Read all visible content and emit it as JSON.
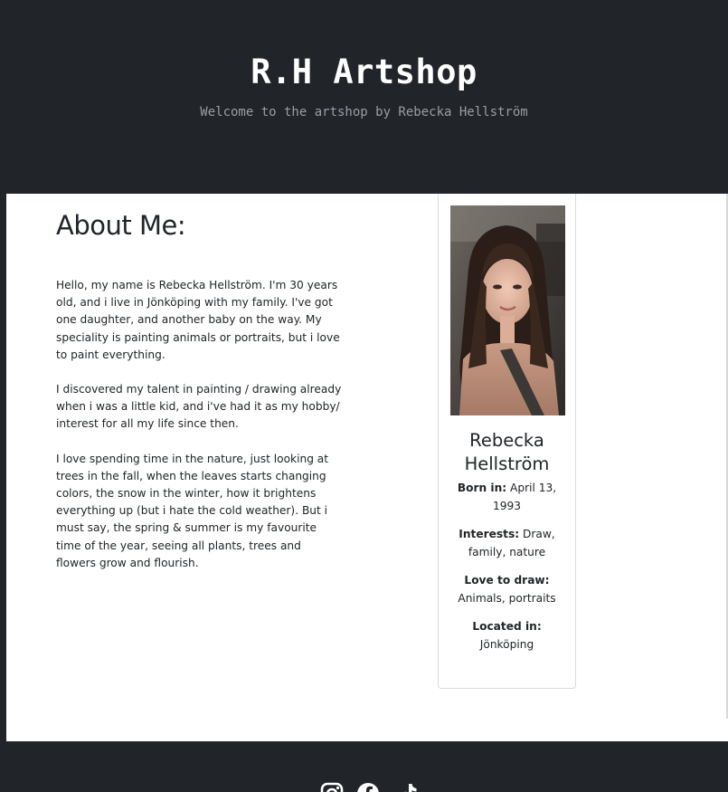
{
  "header": {
    "title": "R.H Artshop",
    "subtitle": "Welcome to the artshop by Rebecka Hellström"
  },
  "about": {
    "heading": "About Me:",
    "paragraphs": [
      "Hello, my name is Rebecka Hellström. I'm 30 years old, and i live in Jönköping with my family. I've got one daughter, and another baby on the way. My speciality is painting animals or portraits, but i love to paint everything.",
      "I discovered my talent in painting / drawing already when i was a little kid, and i've had it as my hobby/ interest for all my life since then.",
      "I love spending time in the nature, just looking at trees in the fall, when the leaves starts changing colors, the snow in the winter, how it brightens everything up (but i hate the cold weather). But i must say, the spring & summer is my favourite time of the year, seeing all plants, trees and flowers grow and flourish."
    ]
  },
  "profile_card": {
    "name_line1": "Rebecka",
    "name_line2": "Hellström",
    "born_label": "Born in:",
    "born_value": "April 13, 1993",
    "interests_label": "Interests:",
    "interests_value": "Draw, family, nature",
    "draw_label": "Love to draw:",
    "draw_value": "Animals, portraits",
    "located_label": "Located in:",
    "located_value": "Jönköping"
  },
  "footer": {
    "social_icons": [
      "instagram-icon",
      "facebook-icon",
      "tiktok-icon"
    ]
  }
}
